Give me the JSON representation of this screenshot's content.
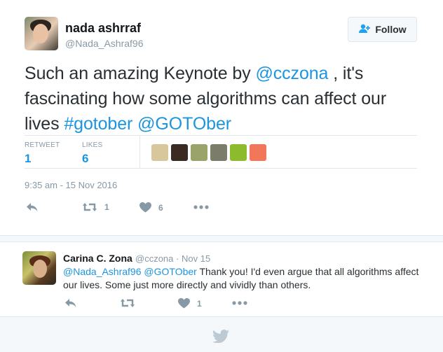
{
  "tweet": {
    "author_name": "nada ashrraf",
    "author_handle": "@Nada_Ashraf96",
    "follow_label": "Follow",
    "text_parts": {
      "p1": "Such an amazing Keynote by ",
      "mention1": "@cczona",
      "p2": " , it's fascinating how some algorithms can affect our lives ",
      "hashtag": "#gotober",
      "p3": " ",
      "mention2": "@GOTOber"
    },
    "retweets_label": "RETWEET",
    "retweets_count": "1",
    "likes_label": "LIKES",
    "likes_count": "6",
    "timestamp": "9:35 am - 15 Nov 2016",
    "actions": {
      "retweet_count": "1",
      "like_count": "6"
    },
    "liker_colors": [
      "#d8c79c",
      "#3a2a22",
      "#9aa36a",
      "#7c7c6a",
      "#8dbb2e",
      "#f2765a"
    ]
  },
  "reply": {
    "author_name": "Carina C. Zona",
    "author_handle": "@cczona",
    "separator": "·",
    "date": "Nov 15",
    "mention1": "@Nada_Ashraf96",
    "mention2": "@GOTOber",
    "text": " Thank you! I'd even argue that all algorithms affect our lives. Some just more directly and vividly than others.",
    "actions": {
      "like_count": "1"
    }
  },
  "colors": {
    "accent": "#1b95e0",
    "muted": "#8899a6",
    "border": "#e1e8ed"
  },
  "icons": [
    "follow-person-icon",
    "reply-icon",
    "retweet-icon",
    "heart-icon",
    "more-icon",
    "twitter-bird-icon"
  ]
}
